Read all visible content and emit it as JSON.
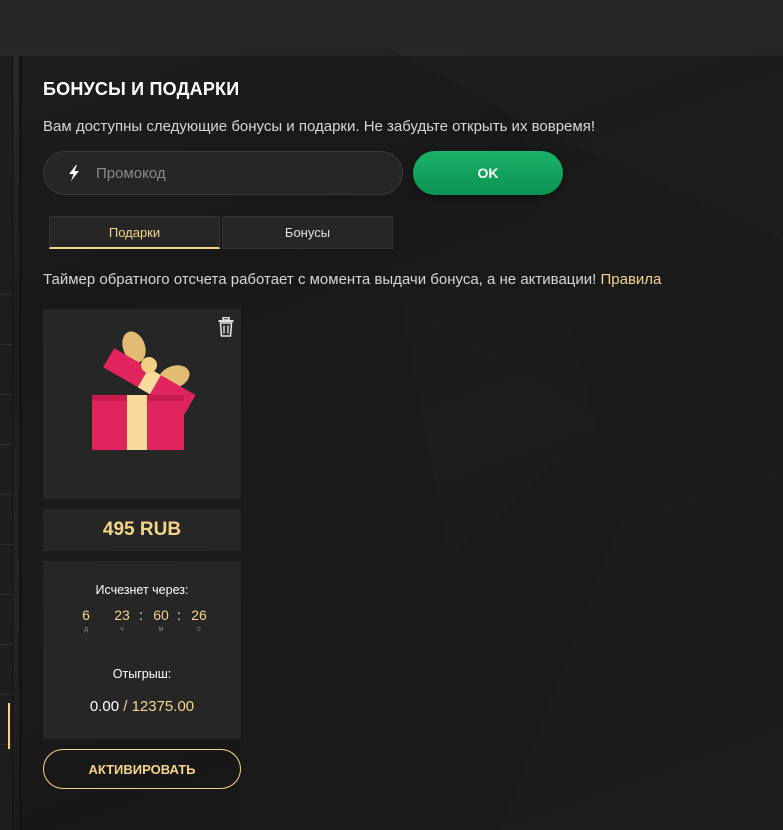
{
  "section": {
    "title": "БОНУСЫ И ПОДАРКИ",
    "subtitle": "Вам доступны следующие бонусы и подарки. Не забудьте открыть их вовремя!"
  },
  "promo": {
    "placeholder": "Промокод",
    "icon": "lightning-icon",
    "ok_label": "OK"
  },
  "tabs": [
    {
      "label": "Подарки",
      "active": true
    },
    {
      "label": "Бонусы",
      "active": false
    }
  ],
  "notice": {
    "text": "Таймер обратного отсчета работает с момента выдачи бонуса, а не активации!",
    "link": "Правила"
  },
  "gift_card": {
    "image_icon": "gift-box-icon",
    "delete_icon": "trash-icon",
    "amount": "495 RUB",
    "expires_label": "Исчезнет через:",
    "timer": {
      "days": "6",
      "days_unit": "д",
      "hours": "23",
      "hours_unit": "ч",
      "minutes": "60",
      "minutes_unit": "м",
      "seconds": "26",
      "seconds_unit": "с"
    },
    "wager_label": "Отыгрыш:",
    "wager_current": "0.00",
    "wager_separator": "/",
    "wager_total": "12375.00",
    "activate_label": "АКТИВИРОВАТЬ"
  },
  "colors": {
    "accent": "#f5d48a",
    "ok_button": "#12a35c",
    "panel": "#262626",
    "gift_red": "#e0245e",
    "gift_ribbon": "#f9dc9b"
  }
}
